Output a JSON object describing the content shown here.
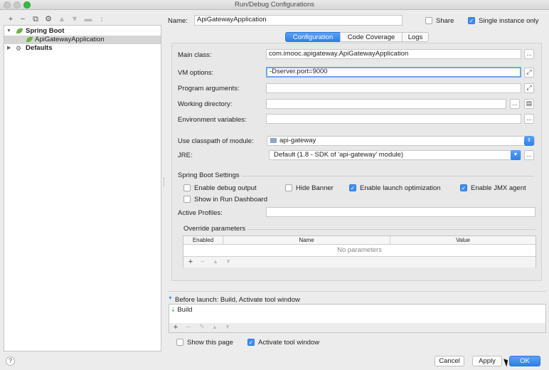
{
  "window": {
    "title": "Run/Debug Configurations"
  },
  "tree": {
    "toolbar": [
      "+",
      "−",
      "⧉",
      "⚙",
      "▲",
      "▼",
      "▬",
      "↕"
    ],
    "items": [
      {
        "label": "Spring Boot",
        "expanded": true
      },
      {
        "label": "ApiGatewayApplication",
        "selected": true
      },
      {
        "label": "Defaults",
        "expanded": false
      }
    ]
  },
  "header": {
    "name_label": "Name:",
    "name_value": "ApiGatewayApplication",
    "share_label": "Share",
    "share_checked": false,
    "single_instance_label": "Single instance only",
    "single_instance_checked": true
  },
  "tabs": [
    {
      "label": "Configuration",
      "active": true
    },
    {
      "label": "Code Coverage",
      "active": false
    },
    {
      "label": "Logs",
      "active": false
    }
  ],
  "config": {
    "main_class_label": "Main class:",
    "main_class_value": "com.imooc.apigateway.ApiGatewayApplication",
    "vm_options_label": "VM options:",
    "vm_options_value": "-Dserver.port=9000",
    "program_args_label": "Program arguments:",
    "program_args_value": "",
    "working_dir_label": "Working directory:",
    "working_dir_value": "",
    "env_vars_label": "Environment variables:",
    "env_vars_value": "",
    "classpath_label": "Use classpath of module:",
    "classpath_value": "api-gateway",
    "jre_label": "JRE:",
    "jre_value": "Default (1.8 - SDK of 'api-gateway' module)",
    "dots": "..."
  },
  "spring_boot": {
    "section_label": "Spring Boot Settings",
    "enable_debug_label": "Enable debug output",
    "enable_debug_checked": false,
    "hide_banner_label": "Hide Banner",
    "hide_banner_checked": false,
    "launch_opt_label": "Enable launch optimization",
    "launch_opt_checked": true,
    "jmx_label": "Enable JMX agent",
    "jmx_checked": true,
    "run_dashboard_label": "Show in Run Dashboard",
    "run_dashboard_checked": false,
    "active_profiles_label": "Active Profiles:",
    "active_profiles_value": ""
  },
  "override": {
    "section_label": "Override parameters",
    "columns": [
      "Enabled",
      "Name",
      "Value"
    ],
    "empty_text": "No parameters",
    "toolbar": [
      "+",
      "−",
      "▲",
      "▼"
    ]
  },
  "before_launch": {
    "label": "Before launch: Build, Activate tool window",
    "items": [
      "Build"
    ],
    "toolbar": [
      "+",
      "−",
      "✎",
      "▲",
      "▼"
    ]
  },
  "footer": {
    "show_page_label": "Show this page",
    "show_page_checked": false,
    "activate_tool_label": "Activate tool window",
    "activate_tool_checked": true,
    "help": "?",
    "cancel_label": "Cancel",
    "apply_label": "Apply",
    "ok_label": "OK"
  },
  "colors": {
    "accent": "#3d8ef0",
    "focus": "#6aa7ea",
    "selection": "#d5d5d5"
  }
}
